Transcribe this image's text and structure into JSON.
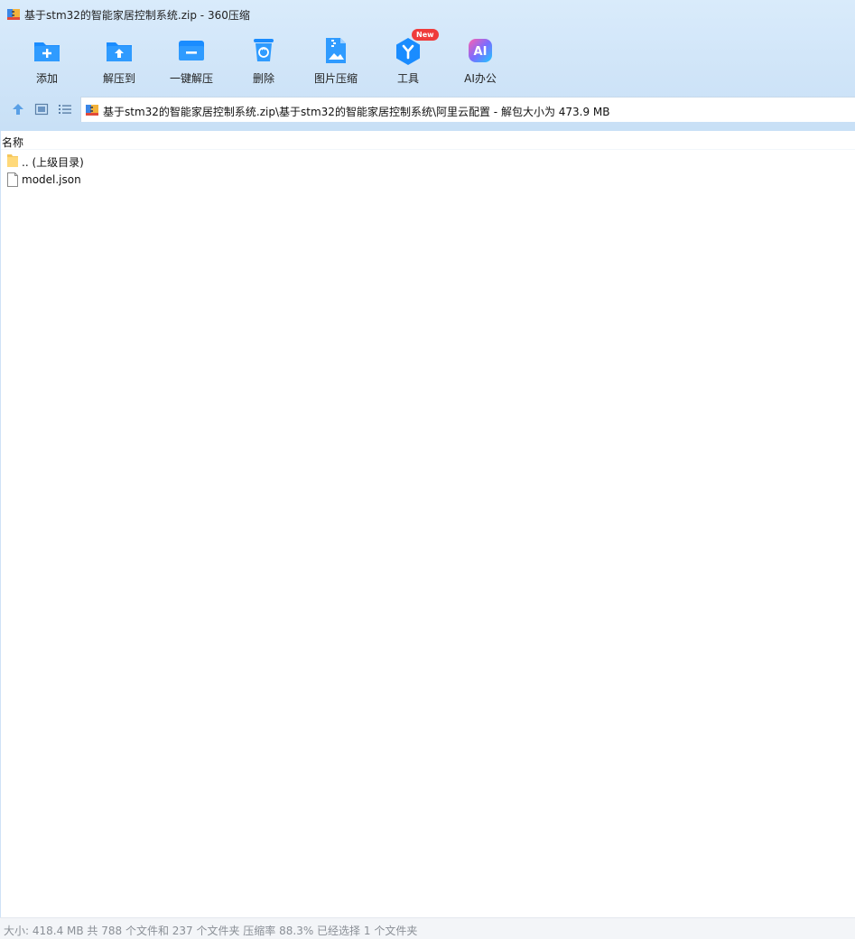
{
  "window": {
    "title": "基于stm32的智能家居控制系统.zip - 360压缩"
  },
  "toolbar": {
    "items": [
      {
        "label": "添加",
        "icon": "add-folder-icon"
      },
      {
        "label": "解压到",
        "icon": "extract-to-icon"
      },
      {
        "label": "一键解压",
        "icon": "one-click-extract-icon"
      },
      {
        "label": "删除",
        "icon": "trash-icon"
      },
      {
        "label": "图片压缩",
        "icon": "image-compress-icon"
      },
      {
        "label": "工具",
        "icon": "tools-icon",
        "badge": "New"
      },
      {
        "label": "AI办公",
        "icon": "ai-office-icon",
        "icon_text": "AI"
      }
    ]
  },
  "nav": {
    "address": "基于stm32的智能家居控制系统.zip\\基于stm32的智能家居控制系统\\阿里云配置 - 解包大小为 473.9 MB"
  },
  "list": {
    "column_name": "名称",
    "rows": [
      {
        "name": ".. (上级目录)",
        "type": "folder"
      },
      {
        "name": "model.json",
        "type": "file"
      }
    ]
  },
  "status": {
    "text": "大小: 418.4 MB 共 788 个文件和 237 个文件夹 压缩率 88.3% 已经选择 1 个文件夹"
  },
  "colors": {
    "accent": "#1a8cff",
    "toolbar_bg": "#d3e6f9",
    "badge": "#ef3b3b"
  }
}
